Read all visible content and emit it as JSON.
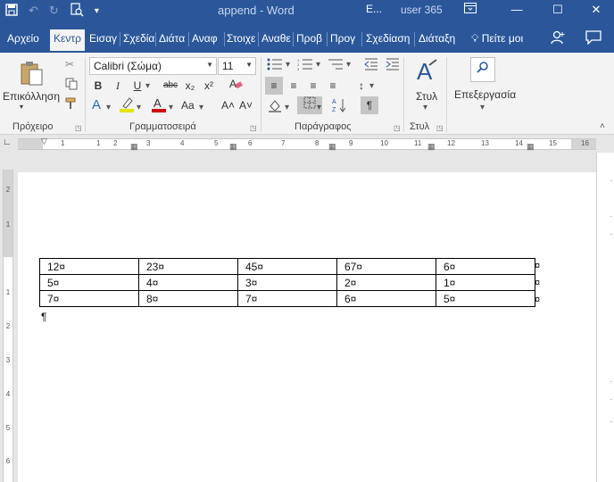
{
  "window": {
    "title": "append  -  Word",
    "account_box": "E...",
    "user": "user 365"
  },
  "qat": {
    "save_icon": "save-icon",
    "undo_icon": "undo-icon",
    "redo_icon": "redo-icon",
    "print_preview_icon": "print-preview-icon",
    "customize_icon": "customize-qat-icon"
  },
  "tabs": [
    {
      "label": "Αρχείο"
    },
    {
      "label": "Κεντρ"
    },
    {
      "label": "Εισαγ"
    },
    {
      "label": "Σχεδία"
    },
    {
      "label": "Διάτα"
    },
    {
      "label": "Αναφ"
    },
    {
      "label": "Στοιχε"
    },
    {
      "label": "Αναθε"
    },
    {
      "label": "Προβ"
    },
    {
      "label": "Προγ"
    },
    {
      "label": "Σχεδίαση"
    },
    {
      "label": "Διάταξη"
    }
  ],
  "tell_me": "Πείτε μοι",
  "ribbon": {
    "paste_label": "Επικόλληση",
    "clipboard_label": "Πρόχειρο",
    "font_name": "Calibri (Σώμα)",
    "font_size": "11",
    "font_label": "Γραμματοσειρά",
    "paragraph_label": "Παράγραφος",
    "styles_button": "Στυλ",
    "styles_label": "Στυλ",
    "editing_button": "Επεξεργασία",
    "bold": "B",
    "italic": "I",
    "underline": "U",
    "strike": "abc",
    "subscript": "x₂",
    "superscript": "x²",
    "case": "Aa",
    "grow": "A˄",
    "shrink": "A˅",
    "show_marks": "¶",
    "accent_text": "#e4e400",
    "accent_red": "#d00000"
  },
  "hruler": {
    "numbers": [
      "1",
      "1",
      "2",
      "3",
      "4",
      "5",
      "6",
      "7",
      "8",
      "9",
      "10",
      "11",
      "12",
      "13",
      "14",
      "15",
      "16"
    ]
  },
  "vruler": {
    "numbers": [
      "2",
      "1",
      "1",
      "2",
      "3",
      "4",
      "5",
      "6"
    ]
  },
  "document": {
    "table": [
      [
        "12¤",
        "23¤",
        "45¤",
        "67¤",
        "6¤"
      ],
      [
        "5¤",
        "4¤",
        "3¤",
        "2¤",
        "1¤"
      ],
      [
        "7¤",
        "8¤",
        "7¤",
        "6¤",
        "5¤"
      ]
    ],
    "row_end_mark": "¤",
    "paragraph_mark": "¶"
  }
}
